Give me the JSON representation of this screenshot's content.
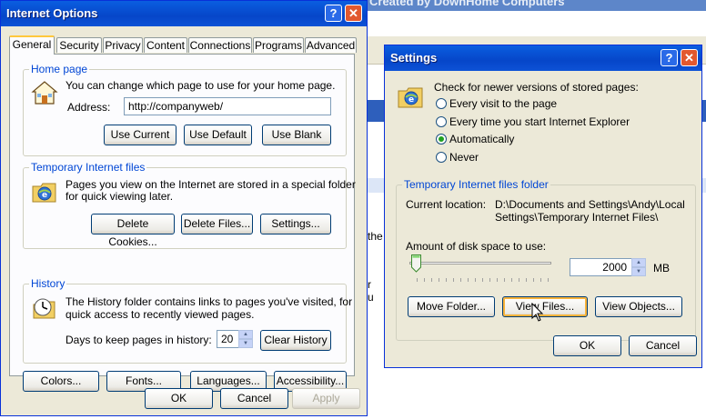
{
  "background": {
    "title": "Created by DownHome Computers",
    "text_lines": [
      "the",
      "r",
      "u"
    ]
  },
  "internet_options": {
    "title": "Internet Options",
    "tabs": [
      "General",
      "Security",
      "Privacy",
      "Content",
      "Connections",
      "Programs",
      "Advanced"
    ],
    "home_page": {
      "legend": "Home page",
      "description": "You can change which page to use for your home page.",
      "address_label": "Address:",
      "address_value": "http://companyweb/",
      "use_current": "Use Current",
      "use_default": "Use Default",
      "use_blank": "Use Blank"
    },
    "temp_files": {
      "legend": "Temporary Internet files",
      "description_line1": "Pages you view on the Internet are stored in a special folder",
      "description_line2": "for quick viewing later.",
      "delete_cookies": "Delete Cookies...",
      "delete_files": "Delete Files...",
      "settings": "Settings..."
    },
    "history": {
      "legend": "History",
      "description_line1": "The History folder contains links to pages you've visited, for",
      "description_line2": "quick access to recently viewed pages.",
      "days_label": "Days to keep pages in history:",
      "days_value": "20",
      "clear_history": "Clear History"
    },
    "bottom_buttons": {
      "colors": "Colors...",
      "fonts": "Fonts...",
      "languages": "Languages...",
      "accessibility": "Accessibility..."
    },
    "ok": "OK",
    "cancel": "Cancel",
    "apply": "Apply"
  },
  "settings": {
    "title": "Settings",
    "check_label": "Check for newer versions of stored pages:",
    "options": [
      "Every visit to the page",
      "Every time you start Internet Explorer",
      "Automatically",
      "Never"
    ],
    "selected_option": "Automatically",
    "folder_legend": "Temporary Internet files folder",
    "current_location_label": "Current location:",
    "current_location_line1": "D:\\Documents and Settings\\Andy\\Local",
    "current_location_line2": "Settings\\Temporary Internet Files\\",
    "disk_space_label": "Amount of disk space to use:",
    "disk_space_value": "2000",
    "disk_space_unit": "MB",
    "move_folder": "Move Folder...",
    "view_files": "View Files...",
    "view_objects": "View Objects...",
    "ok": "OK",
    "cancel": "Cancel"
  }
}
